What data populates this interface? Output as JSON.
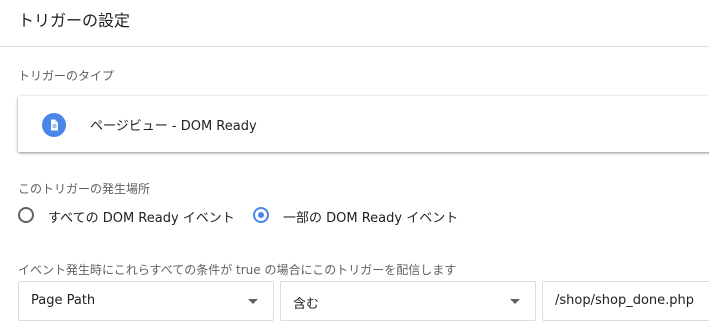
{
  "header": {
    "title": "トリガーの設定"
  },
  "trigger_type": {
    "label": "トリガーのタイプ",
    "icon": "document-icon",
    "name": "ページビュー - DOM Ready",
    "accent_color": "#4a86e8"
  },
  "occurrence": {
    "label": "このトリガーの発生場所",
    "options": [
      {
        "label": "すべての DOM Ready イベント",
        "selected": false
      },
      {
        "label": "一部の DOM Ready イベント",
        "selected": true
      }
    ]
  },
  "condition": {
    "label": "イベント発生時にこれらすべての条件が true の場合にこのトリガーを配信します",
    "variable": "Page Path",
    "operator": "含む",
    "value": "/shop/shop_done.php"
  }
}
